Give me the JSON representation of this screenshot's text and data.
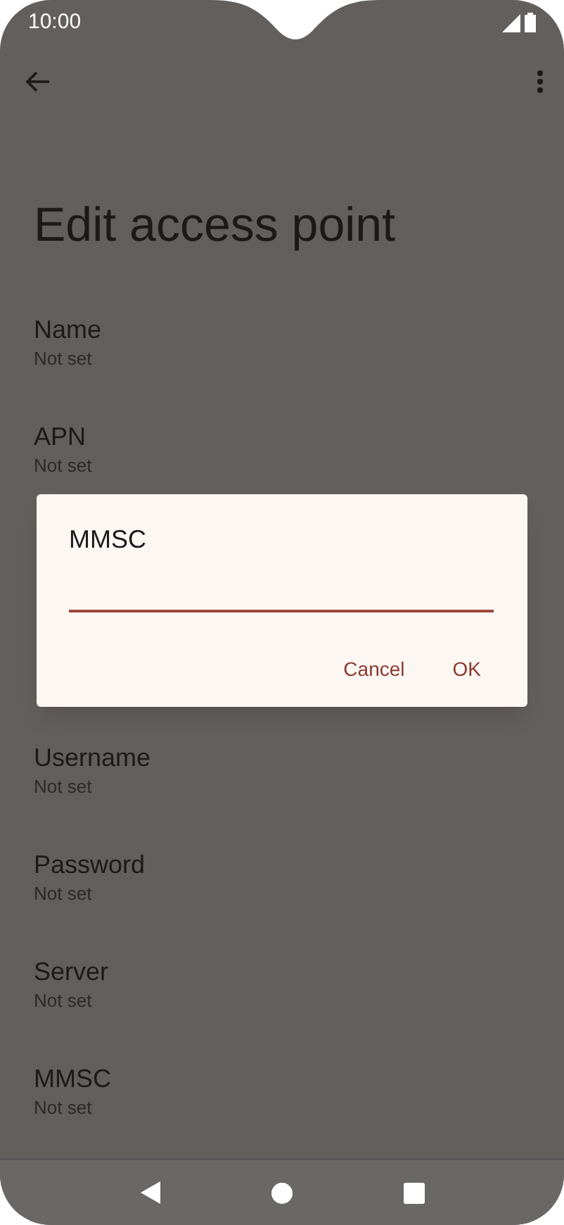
{
  "status_bar": {
    "time": "10:00"
  },
  "title": "Edit access point",
  "settings": [
    {
      "label": "Name",
      "value": "Not set"
    },
    {
      "label": "APN",
      "value": "Not set"
    },
    {
      "label": "Username",
      "value": "Not set"
    },
    {
      "label": "Password",
      "value": "Not set"
    },
    {
      "label": "Server",
      "value": "Not set"
    },
    {
      "label": "MMSC",
      "value": "Not set"
    }
  ],
  "dialog": {
    "title": "MMSC",
    "buttons": [
      "Cancel",
      "OK"
    ]
  }
}
